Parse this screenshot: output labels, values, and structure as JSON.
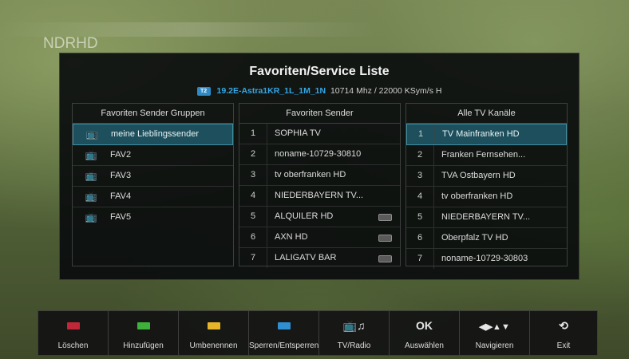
{
  "channel_logo": {
    "main": "NDR",
    "suffix": "HD"
  },
  "dialog": {
    "title": "Favoriten/Service Liste",
    "satellite": {
      "tag": "T2",
      "name": "19.2E-Astra1KR_1L_1M_1N",
      "details": "10714 Mhz / 22000 KSym/s H"
    }
  },
  "groups": {
    "header": "Favoriten Sender Gruppen",
    "items": [
      "meine Lieblingssender",
      "FAV2",
      "FAV3",
      "FAV4",
      "FAV5"
    ],
    "icon": "tv-icon"
  },
  "favorites": {
    "header": "Favoriten Sender",
    "items": [
      {
        "num": "1",
        "name": "SOPHIA TV"
      },
      {
        "num": "2",
        "name": "noname-10729-30810"
      },
      {
        "num": "3",
        "name": "tv oberfranken HD"
      },
      {
        "num": "4",
        "name": "NIEDERBAYERN TV..."
      },
      {
        "num": "5",
        "name": "ALQUILER HD"
      },
      {
        "num": "6",
        "name": "AXN HD"
      },
      {
        "num": "7",
        "name": "LALIGATV BAR"
      }
    ]
  },
  "all_channels": {
    "header": "Alle TV Kanäle",
    "items": [
      {
        "num": "1",
        "name": "TV Mainfranken HD"
      },
      {
        "num": "2",
        "name": "Franken Fernsehen..."
      },
      {
        "num": "3",
        "name": "TVA Ostbayern HD"
      },
      {
        "num": "4",
        "name": "tv oberfranken HD"
      },
      {
        "num": "5",
        "name": "NIEDERBAYERN TV..."
      },
      {
        "num": "6",
        "name": "Oberpfalz TV HD"
      },
      {
        "num": "7",
        "name": "noname-10729-30803"
      }
    ]
  },
  "toolbar": {
    "loeschen": "Löschen",
    "hinzufuegen": "Hinzufügen",
    "umbenennen": "Umbenennen",
    "sperren": "Sperren/Entsperren",
    "tvradio": "TV/Radio",
    "auswaehlen": "Auswählen",
    "navigieren": "Navigieren",
    "exit": "Exit",
    "ok_key": "OK",
    "colors": {
      "red": "#c0283a",
      "green": "#3fb03a",
      "yellow": "#e6b52a",
      "blue": "#2f8fd0"
    }
  },
  "colors": {
    "accent": "#35a7e6",
    "selection": "#1d4f5c"
  }
}
